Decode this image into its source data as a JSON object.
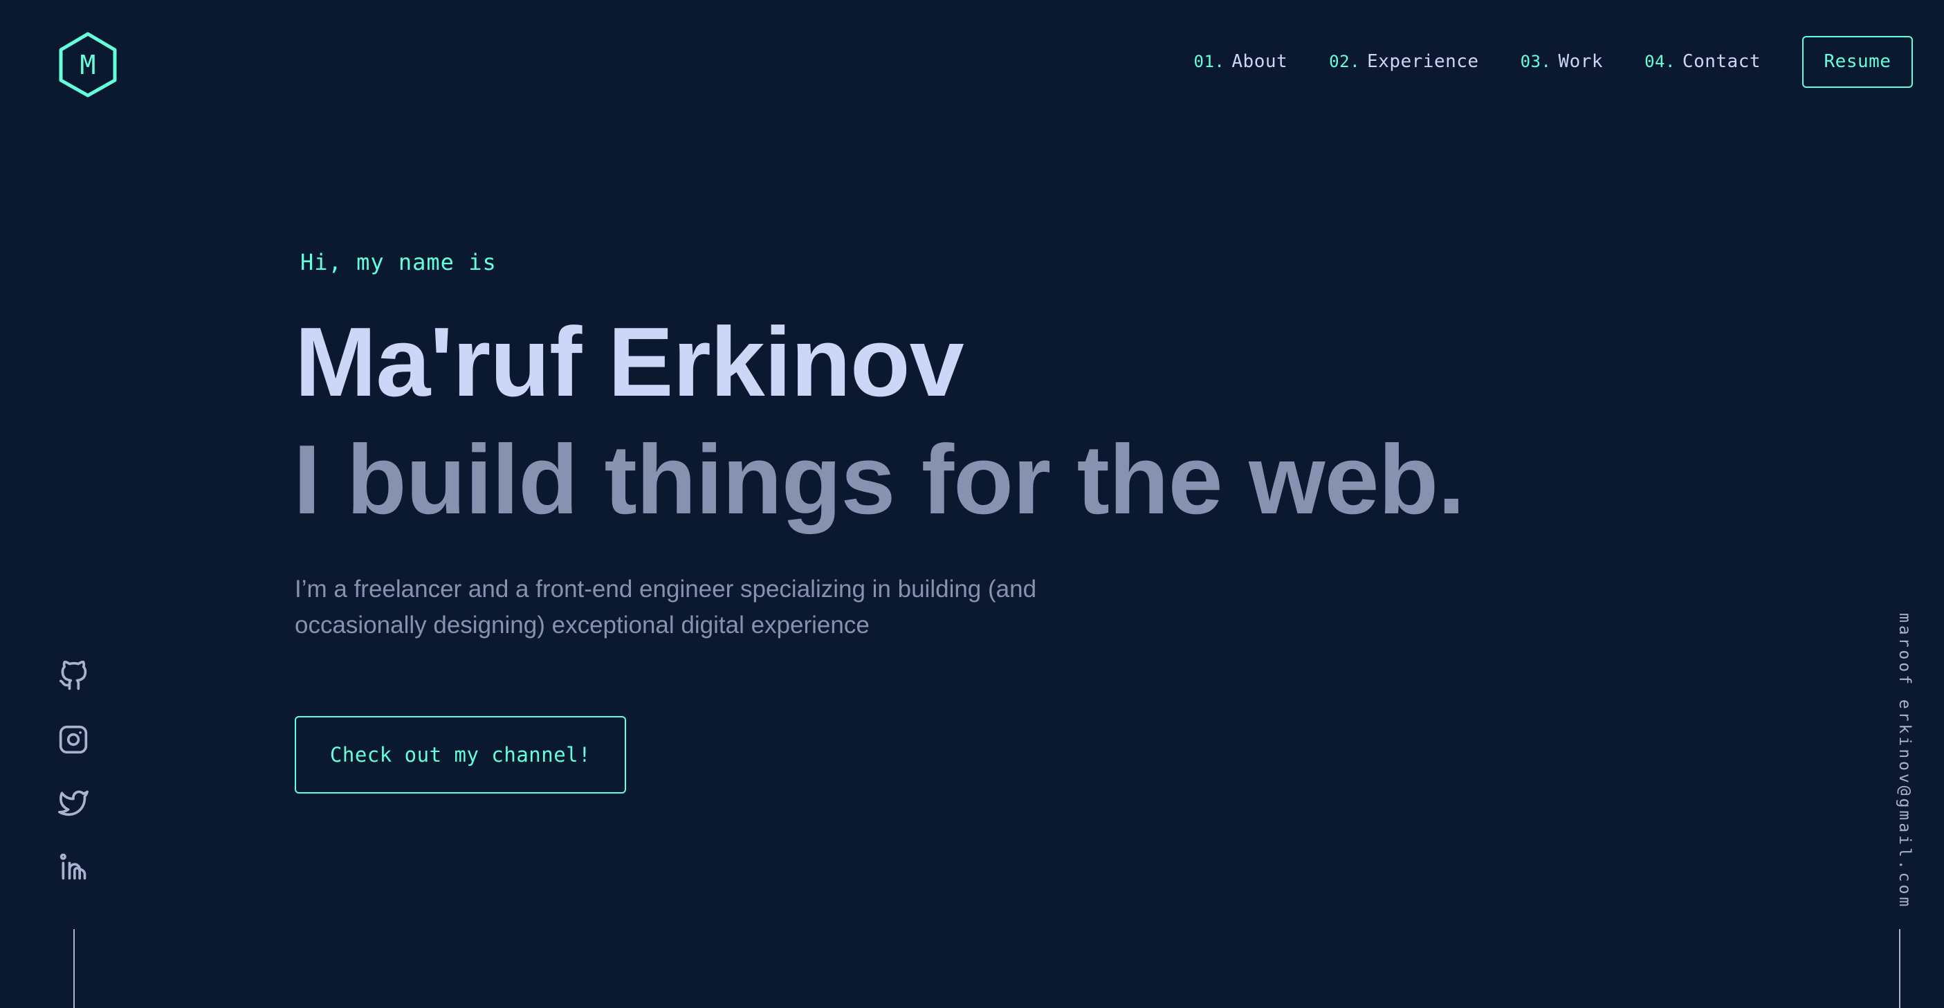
{
  "logo": {
    "letter": "M",
    "icon": "hexagon-logo-icon"
  },
  "nav": {
    "items": [
      {
        "num": "01.",
        "label": "About"
      },
      {
        "num": "02.",
        "label": "Experience"
      },
      {
        "num": "03.",
        "label": "Work"
      },
      {
        "num": "04.",
        "label": "Contact"
      }
    ],
    "resume_label": "Resume"
  },
  "hero": {
    "greeting": "Hi, my name is",
    "name": "Ma'ruf Erkinov",
    "tagline": "I build things for the web.",
    "intro": "I’m a freelancer and a front-end engineer specializing in building (and occasionally designing) exceptional digital experience",
    "cta_label": "Check out my channel!"
  },
  "social": {
    "icons": [
      "github-icon",
      "instagram-icon",
      "twitter-icon",
      "linkedin-icon"
    ]
  },
  "email": "maroof erkinov@gmail.com",
  "colors": {
    "background": "#0a192f",
    "accent": "#64ffda",
    "heading": "#ccd6f6",
    "muted": "#8892b0",
    "icon": "#a8b2d1"
  }
}
